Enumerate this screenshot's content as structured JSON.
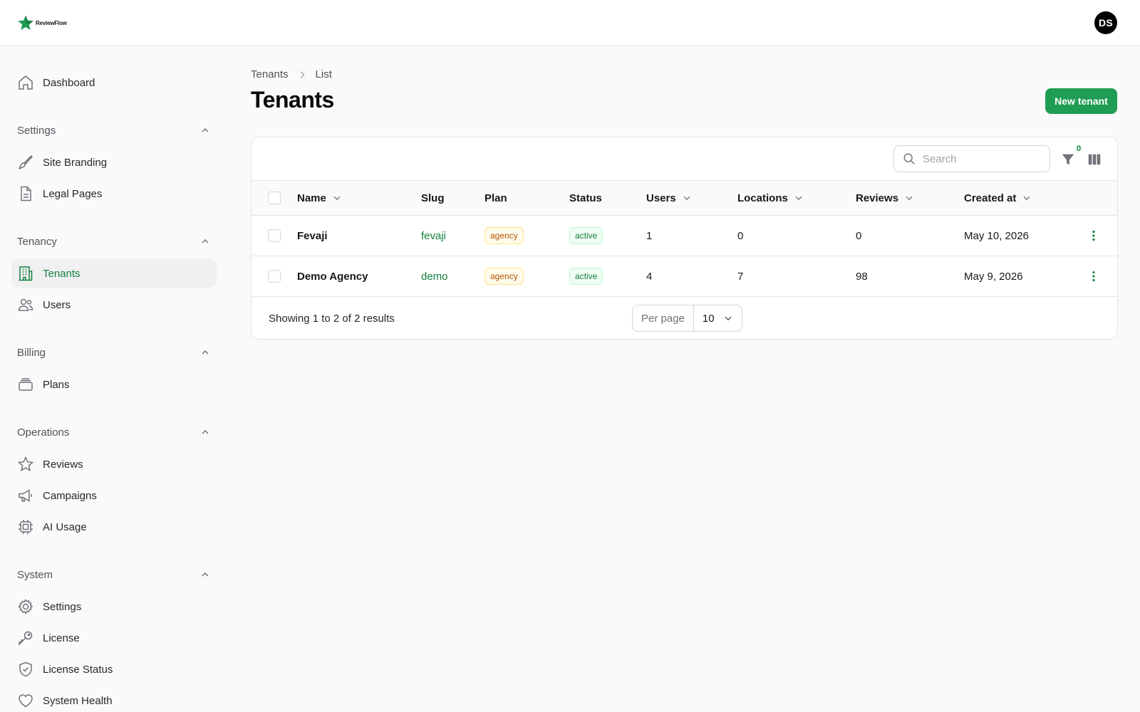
{
  "app": {
    "logo_text": "ReviewFlow",
    "user_initials": "DS"
  },
  "sidebar": {
    "dashboard": "Dashboard",
    "groups": [
      {
        "label": "Settings",
        "items": [
          "Site Branding",
          "Legal Pages"
        ]
      },
      {
        "label": "Tenancy",
        "items": [
          "Tenants",
          "Users"
        ]
      },
      {
        "label": "Billing",
        "items": [
          "Plans"
        ]
      },
      {
        "label": "Operations",
        "items": [
          "Reviews",
          "Campaigns",
          "AI Usage"
        ]
      },
      {
        "label": "System",
        "items": [
          "Settings",
          "License",
          "License Status",
          "System Health"
        ]
      }
    ],
    "active": "Tenants"
  },
  "breadcrumb": [
    "Tenants",
    "List"
  ],
  "page": {
    "title": "Tenants",
    "new_button": "New tenant"
  },
  "toolbar": {
    "search_placeholder": "Search",
    "filter_count": "0"
  },
  "table": {
    "columns": [
      "Name",
      "Slug",
      "Plan",
      "Status",
      "Users",
      "Locations",
      "Reviews",
      "Created at"
    ],
    "rows": [
      {
        "name": "Fevaji",
        "slug": "fevaji",
        "plan": "agency",
        "status": "active",
        "users": "1",
        "locations": "0",
        "reviews": "0",
        "created": "May 10, 2026"
      },
      {
        "name": "Demo Agency",
        "slug": "demo",
        "plan": "agency",
        "status": "active",
        "users": "4",
        "locations": "7",
        "reviews": "98",
        "created": "May 9, 2026"
      }
    ]
  },
  "pagination": {
    "results_text": "Showing 1 to 2 of 2 results",
    "per_page_label": "Per page",
    "per_page_value": "10"
  },
  "colors": {
    "accent": "#1f9d55",
    "accent_text": "#15803d",
    "plan_badge": "#b45309",
    "status_badge": "#15803d"
  }
}
